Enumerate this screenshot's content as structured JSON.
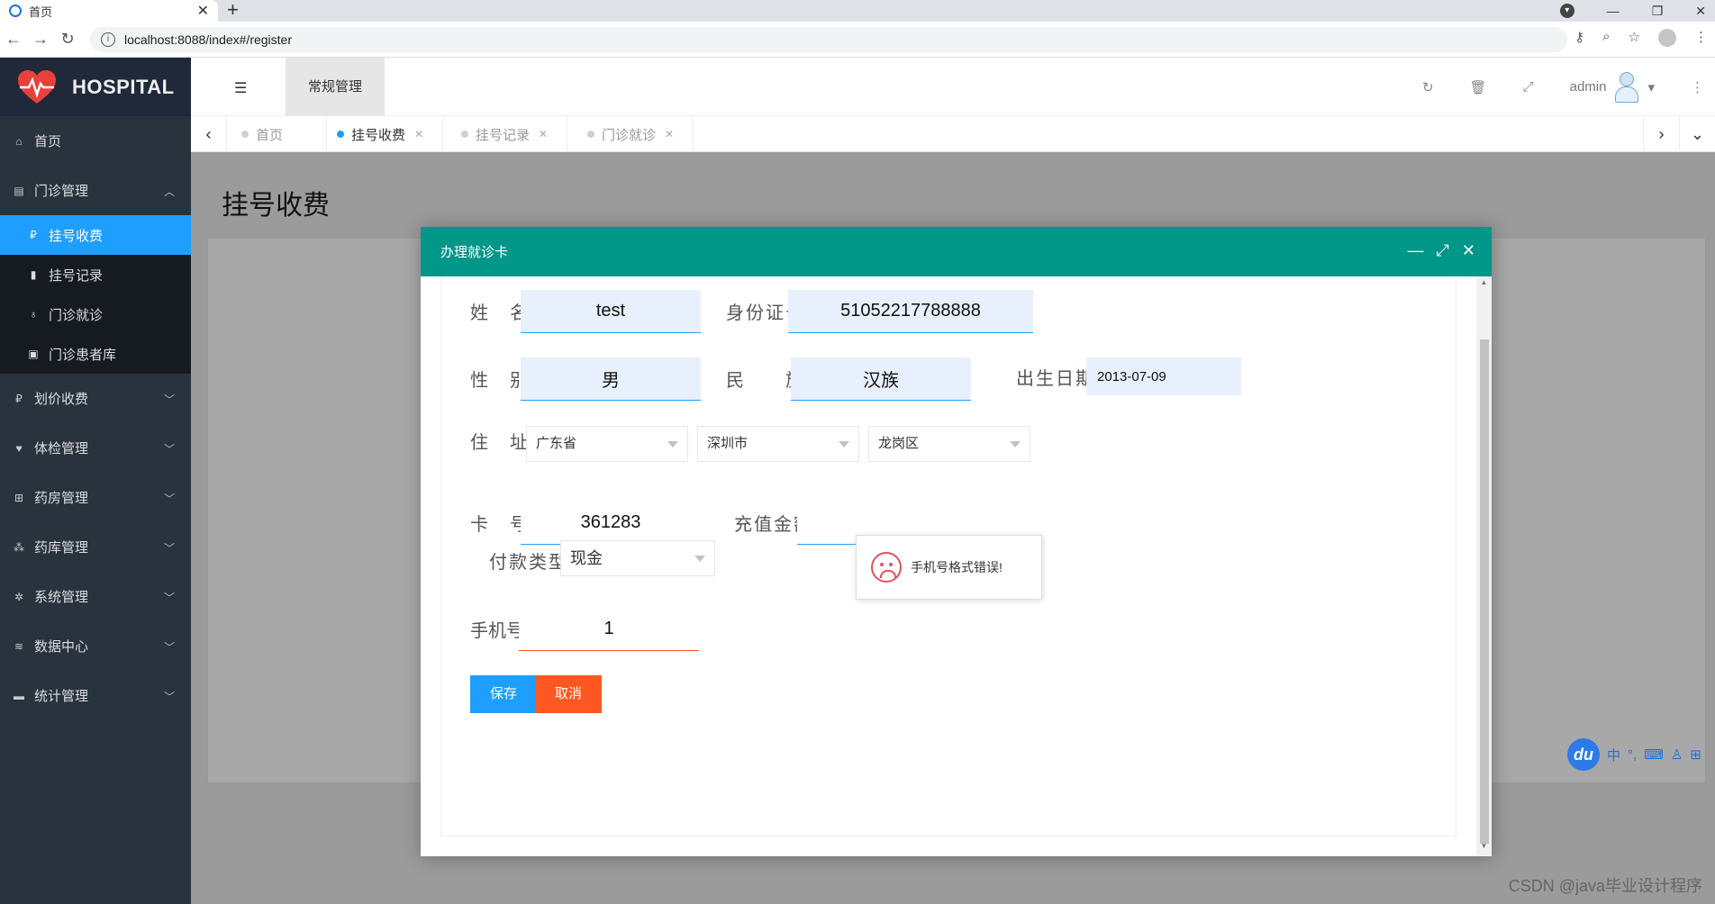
{
  "browser": {
    "tab_title": "首页",
    "new_tab": "+",
    "url": "localhost:8088/index#/register"
  },
  "app": {
    "logo_text": "HOSPITAL",
    "header_tab": "常规管理",
    "admin_name": "admin"
  },
  "sidebar": {
    "home": "首页",
    "outpatient": "门诊管理",
    "sub_items": [
      "挂号收费",
      "挂号记录",
      "门诊就诊",
      "门诊患者库"
    ],
    "groups": [
      "划价收费",
      "体检管理",
      "药房管理",
      "药库管理",
      "系统管理",
      "数据中心",
      "统计管理"
    ]
  },
  "tabs": [
    "首页",
    "挂号收费",
    "挂号记录",
    "门诊就诊"
  ],
  "page": {
    "title": "挂号收费"
  },
  "modal": {
    "title": "办理就诊卡",
    "labels": {
      "name": "姓　名",
      "id_card": "身份证号",
      "gender": "性　别",
      "ethnicity": "民　　族",
      "birth": "出生日期",
      "address": "住　址",
      "card_no": "卡　号",
      "recharge": "充值金额",
      "pay_type": "付款类型",
      "phone": "手机号"
    },
    "values": {
      "name": "test",
      "id_card": "51052217788888",
      "gender": "男",
      "ethnicity": "汉族",
      "birth": "2013-07-09",
      "province": "广东省",
      "city": "深圳市",
      "district": "龙岗区",
      "card_no": "361283",
      "pay_type": "现金",
      "phone": "1"
    },
    "buttons": {
      "save": "保存",
      "cancel": "取消"
    },
    "toast": "手机号格式错误!"
  },
  "ime": {
    "logo": "du",
    "lang": "中"
  },
  "watermark": "CSDN @java毕业设计程序",
  "colors": {
    "sidebar": "#28333e",
    "active": "#1e9fff",
    "modal_header": "#009688",
    "cancel": "#ff5722"
  }
}
